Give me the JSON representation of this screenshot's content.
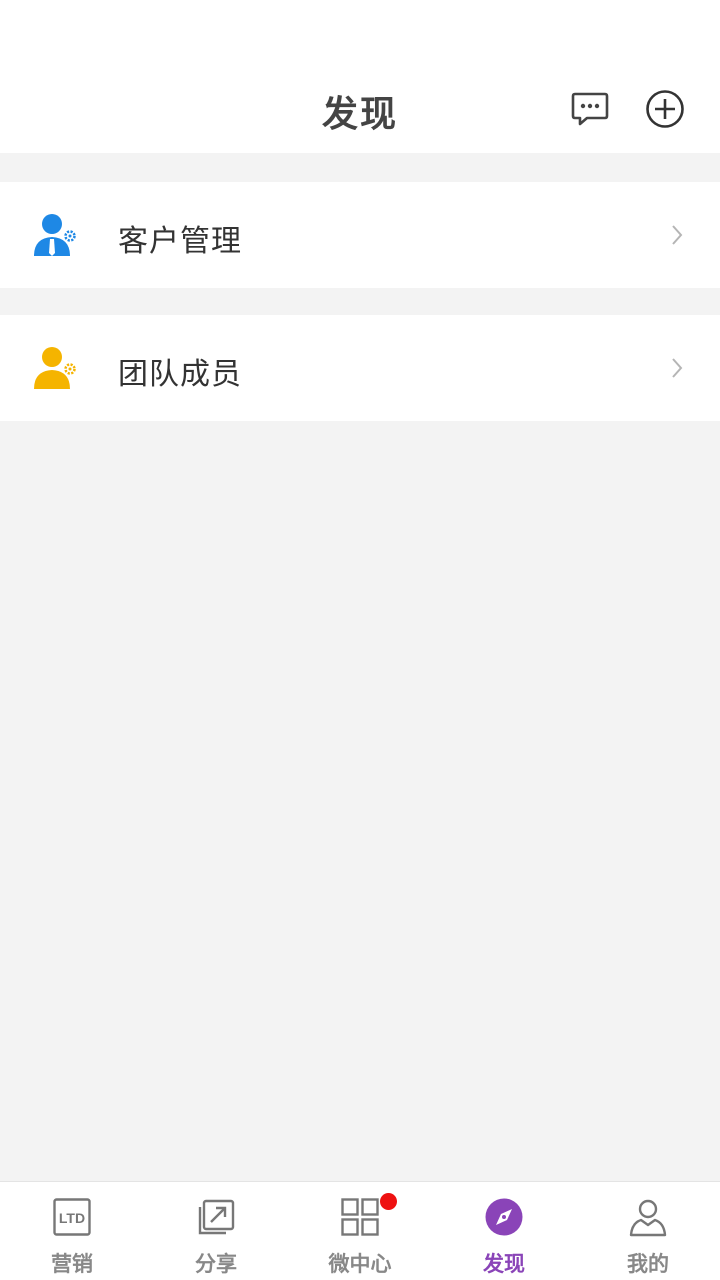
{
  "header": {
    "title": "发现",
    "message_icon": "message-bubble-icon",
    "add_icon": "plus-circle-icon"
  },
  "menu": [
    {
      "label": "客户管理",
      "icon": "customer-gear-icon",
      "icon_color": "#1e88e5"
    },
    {
      "label": "团队成员",
      "icon": "team-gear-icon",
      "icon_color": "#f5b400"
    }
  ],
  "tabbar": {
    "tabs": [
      {
        "label": "营销",
        "icon": "ltd-icon"
      },
      {
        "label": "分享",
        "icon": "share-icon"
      },
      {
        "label": "微中心",
        "icon": "grid-icon",
        "badge": true
      },
      {
        "label": "发现",
        "icon": "compass-icon",
        "active": true
      },
      {
        "label": "我的",
        "icon": "user-icon"
      }
    ],
    "active_color": "#8a44b8",
    "inactive_color": "#888888",
    "badge_color": "#ee1111"
  }
}
